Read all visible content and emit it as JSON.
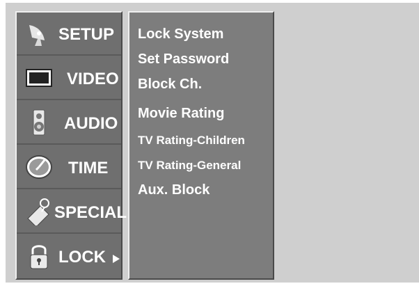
{
  "menu": {
    "tabs": [
      {
        "label": "SETUP",
        "icon": "satellite-dish-icon"
      },
      {
        "label": "VIDEO",
        "icon": "monitor-icon"
      },
      {
        "label": "AUDIO",
        "icon": "speaker-icon"
      },
      {
        "label": "TIME",
        "icon": "clock-icon"
      },
      {
        "label": "SPECIAL",
        "icon": "tag-icon"
      },
      {
        "label": "LOCK",
        "icon": "padlock-icon",
        "selected": true
      }
    ]
  },
  "submenu": {
    "items": [
      {
        "label": "Lock System"
      },
      {
        "label": "Set Password"
      },
      {
        "label": "Block Ch."
      },
      {
        "label": "Movie Rating"
      },
      {
        "label": "TV Rating-Children"
      },
      {
        "label": "TV Rating-General"
      },
      {
        "label": "Aux. Block"
      }
    ]
  },
  "colors": {
    "background": "#cfcfcf",
    "menu_panel": "#6f6f6f",
    "submenu_panel": "#7d7d7d",
    "text": "#ffffff"
  }
}
